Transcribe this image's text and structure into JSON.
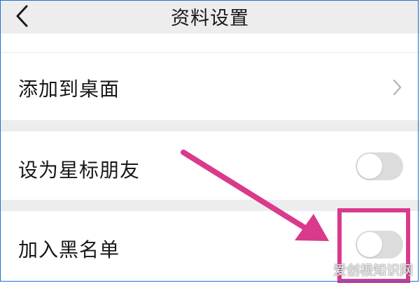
{
  "header": {
    "title": "资料设置",
    "back_icon": "chevron-left-icon"
  },
  "rows": [
    {
      "label": "添加到桌面",
      "control": "chevron-right-icon"
    },
    {
      "label": "设为星标朋友",
      "control": "toggle",
      "on": false
    },
    {
      "label": "加入黑名单",
      "control": "toggle",
      "on": false
    }
  ],
  "annotation": {
    "color": "#d93a8c",
    "target": "加入黑名单 toggle"
  },
  "watermark": "爱创根知识网"
}
